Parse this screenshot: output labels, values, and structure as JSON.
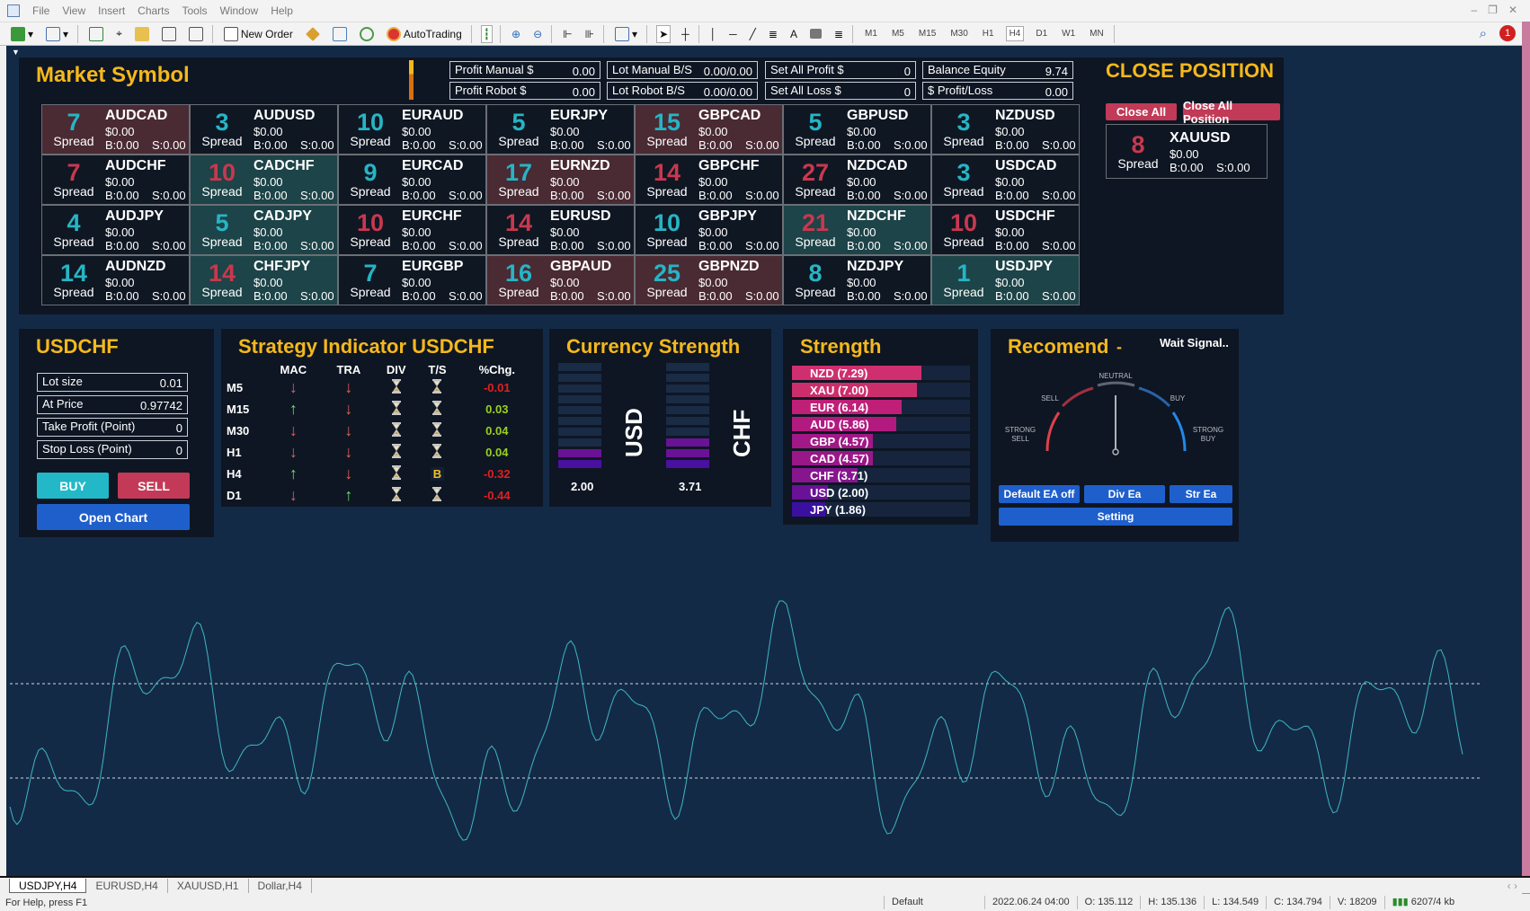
{
  "window": {
    "menu": [
      "File",
      "View",
      "Insert",
      "Charts",
      "Tools",
      "Window",
      "Help"
    ]
  },
  "toolbar": {
    "new_order": "New Order",
    "autotrading": "AutoTrading",
    "timeframes": [
      "M1",
      "M5",
      "M15",
      "M30",
      "H1",
      "H4",
      "D1",
      "W1",
      "MN"
    ],
    "active_timeframe": "H4",
    "notification_count": "1"
  },
  "market": {
    "title": "Market Symbol",
    "spread_label": "Spread",
    "cells": [
      [
        "AUDCAD",
        "7",
        "cyan",
        "red"
      ],
      [
        "AUDUSD",
        "3",
        "cyan",
        "dark"
      ],
      [
        "EURAUD",
        "10",
        "cyan",
        "dark"
      ],
      [
        "EURJPY",
        "5",
        "cyan",
        "dark"
      ],
      [
        "GBPCAD",
        "15",
        "cyan",
        "red"
      ],
      [
        "GBPUSD",
        "5",
        "cyan",
        "dark"
      ],
      [
        "NZDUSD",
        "3",
        "cyan",
        "dark"
      ],
      [
        "AUDCHF",
        "7",
        "red",
        "dark"
      ],
      [
        "CADCHF",
        "10",
        "red",
        "teal"
      ],
      [
        "EURCAD",
        "9",
        "cyan",
        "dark"
      ],
      [
        "EURNZD",
        "17",
        "cyan",
        "red"
      ],
      [
        "GBPCHF",
        "14",
        "red",
        "dark"
      ],
      [
        "NZDCAD",
        "27",
        "red",
        "dark"
      ],
      [
        "USDCAD",
        "3",
        "cyan",
        "dark"
      ],
      [
        "AUDJPY",
        "4",
        "cyan",
        "dark"
      ],
      [
        "CADJPY",
        "5",
        "cyan",
        "teal"
      ],
      [
        "EURCHF",
        "10",
        "red",
        "dark"
      ],
      [
        "EURUSD",
        "14",
        "red",
        "dark"
      ],
      [
        "GBPJPY",
        "10",
        "cyan",
        "dark"
      ],
      [
        "NZDCHF",
        "21",
        "red",
        "teal"
      ],
      [
        "USDCHF",
        "10",
        "red",
        "dark"
      ],
      [
        "AUDNZD",
        "14",
        "cyan",
        "dark"
      ],
      [
        "CHFJPY",
        "14",
        "red",
        "teal"
      ],
      [
        "EURGBP",
        "7",
        "cyan",
        "dark"
      ],
      [
        "GBPAUD",
        "16",
        "cyan",
        "red"
      ],
      [
        "GBPNZD",
        "25",
        "cyan",
        "red"
      ],
      [
        "NZDJPY",
        "8",
        "cyan",
        "dark"
      ],
      [
        "USDJPY",
        "1",
        "cyan",
        "teal"
      ]
    ],
    "profit": "$0.00",
    "buy": "B:0.00",
    "sell": "S:0.00",
    "xau": {
      "symbol": "XAUUSD",
      "spread": "8"
    }
  },
  "summary": [
    {
      "label": "Profit Manual $",
      "value": "0.00"
    },
    {
      "label": "Lot Manual B/S",
      "value": "0.00/0.00"
    },
    {
      "label": "Set All Profit $",
      "value": "0"
    },
    {
      "label": "Balance Equity",
      "value": "9.74"
    },
    {
      "label": "Profit Robot $",
      "value": "0.00"
    },
    {
      "label": "Lot Robot B/S",
      "value": "0.00/0.00"
    },
    {
      "label": "Set All Loss $",
      "value": "0"
    },
    {
      "label": "$ Profit/Loss",
      "value": "0.00"
    }
  ],
  "close": {
    "title": "CLOSE POSITION",
    "close_all": "Close All",
    "close_all_position": "Close All Position"
  },
  "order": {
    "symbol": "USDCHF",
    "fields": [
      {
        "label": "Lot size",
        "value": "0.01"
      },
      {
        "label": "At Price",
        "value": "0.97742"
      },
      {
        "label": "Take Profit (Point)",
        "value": "0"
      },
      {
        "label": "Stop Loss (Point)",
        "value": "0"
      }
    ],
    "buy": "BUY",
    "sell": "SELL",
    "open_chart": "Open Chart"
  },
  "strategy": {
    "title": "Strategy Indicator USDCHF",
    "columns": [
      "MAC",
      "TRA",
      "DIV",
      "T/S",
      "%Chg."
    ],
    "rows": [
      {
        "tf": "M5",
        "mac": "down",
        "tra": "down",
        "div": "wait",
        "ts": "wait",
        "chg": "-0.01"
      },
      {
        "tf": "M15",
        "mac": "up",
        "tra": "down",
        "div": "wait",
        "ts": "wait",
        "chg": "0.03"
      },
      {
        "tf": "M30",
        "mac": "down",
        "tra": "down",
        "div": "wait",
        "ts": "wait",
        "chg": "0.04"
      },
      {
        "tf": "H1",
        "mac": "down",
        "tra": "down",
        "div": "wait",
        "ts": "wait",
        "chg": "0.04"
      },
      {
        "tf": "H4",
        "mac": "up",
        "tra": "down",
        "div": "wait",
        "ts": "B",
        "chg": "-0.32"
      },
      {
        "tf": "D1",
        "mac": "down",
        "tra": "up",
        "div": "wait",
        "ts": "wait",
        "chg": "-0.44"
      }
    ]
  },
  "currency_strength": {
    "title": "Currency Strength",
    "base": {
      "name": "USD",
      "value": "2.00"
    },
    "quote": {
      "name": "CHF",
      "value": "3.71"
    }
  },
  "strength": {
    "title": "Strength",
    "items": [
      {
        "label": "NZD (7.29)",
        "value": 7.29,
        "color": "#cf2f6f"
      },
      {
        "label": "XAU (7.00)",
        "value": 7.0,
        "color": "#cc2e6c"
      },
      {
        "label": "EUR (6.14)",
        "value": 6.14,
        "color": "#c01f78"
      },
      {
        "label": "AUD (5.86)",
        "value": 5.86,
        "color": "#b21a80"
      },
      {
        "label": "GBP (4.57)",
        "value": 4.57,
        "color": "#a11886"
      },
      {
        "label": "CAD (4.57)",
        "value": 4.57,
        "color": "#9a1788"
      },
      {
        "label": "CHF (3.71)",
        "value": 3.71,
        "color": "#86158e"
      },
      {
        "label": "USD (2.00)",
        "value": 2.0,
        "color": "#6a1296"
      },
      {
        "label": "JPY (1.86)",
        "value": 1.86,
        "color": "#3b10a0"
      }
    ]
  },
  "recommend": {
    "title": "Recomend",
    "dash": "-",
    "signal": "Wait Signal..",
    "gauge": {
      "neutral": "NEUTRAL",
      "sell": "SELL",
      "buy": "BUY",
      "strong_sell": [
        "STRONG",
        "SELL"
      ],
      "strong_buy": [
        "STRONG",
        "BUY"
      ],
      "needle": 0.5
    },
    "buttons": {
      "default_ea": "Default EA off",
      "div_ea": "Div Ea",
      "str_ea": "Str Ea",
      "setting": "Setting"
    }
  },
  "tabs": [
    "USDJPY,H4",
    "EURUSD,H4",
    "XAUUSD,H1",
    "Dollar,H4"
  ],
  "status": {
    "help": "For Help, press F1",
    "profile": "Default",
    "datetime": "2022.06.24 04:00",
    "open": "O: 135.112",
    "high": "H: 135.136",
    "low": "L: 134.549",
    "close": "C: 134.794",
    "volume": "V: 18209",
    "traffic": "6207/4 kb"
  }
}
